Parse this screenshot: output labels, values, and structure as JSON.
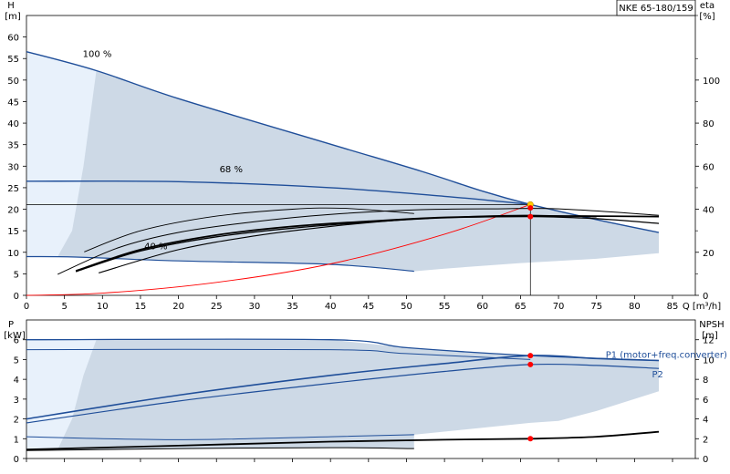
{
  "title": "NKE 65-180/159",
  "colors": {
    "envelope_fill": "#cdd9e6",
    "envelope_light": "#e8f1fb",
    "curve_blue": "#1f4e99",
    "curve_black": "#000000",
    "system_curve": "#ff0000",
    "duty_point": "#ff0000",
    "duty_point_yellow": "#ffcc00",
    "grid": "#000000"
  },
  "chart_data": [
    {
      "type": "line",
      "panel": "head",
      "xlabel": "Q [m³/h]",
      "ylabel_left": "H\n[m]",
      "ylabel_right": "eta\n[%]",
      "xlim": [
        0,
        88
      ],
      "ylim": [
        0,
        65
      ],
      "ylim_right": [
        0,
        130
      ],
      "x_ticks": [
        0,
        5,
        10,
        15,
        20,
        25,
        30,
        35,
        40,
        45,
        50,
        55,
        60,
        65,
        70,
        75,
        80,
        85
      ],
      "y_ticks": [
        0,
        5,
        10,
        15,
        20,
        25,
        30,
        35,
        40,
        45,
        50,
        55,
        60
      ],
      "y_ticks_right": [
        0,
        20,
        40,
        60,
        80,
        100
      ],
      "annotations": [
        "100 %",
        "68 %",
        "40 %"
      ],
      "duty_point": {
        "Q": 66.3,
        "H": 21.1
      },
      "series": [
        {
          "values": [
            [
              0,
              56.6
            ],
            [
              9.2,
              52.2
            ],
            [
              20,
              45.7
            ],
            [
              40,
              35.1
            ],
            [
              52,
              28.8
            ],
            [
              60,
              24.2
            ],
            [
              66.3,
              21.1
            ],
            [
              75,
              17.6
            ],
            [
              83.2,
              14.6
            ]
          ]
        },
        {
          "values": [
            [
              0,
              26.5
            ],
            [
              20,
              26.4
            ],
            [
              40,
              25.0
            ],
            [
              55,
              23.0
            ],
            [
              66.3,
              21.1
            ]
          ]
        },
        {
          "values": [
            [
              0,
              9.0
            ],
            [
              6.5,
              8.9
            ],
            [
              20,
              8.0
            ],
            [
              40,
              7.2
            ],
            [
              51,
              5.6
            ]
          ]
        },
        {
          "values": [
            [
              0,
              0
            ],
            [
              10,
              0.5
            ],
            [
              25,
              3.0
            ],
            [
              40,
              7.3
            ],
            [
              55,
              14.2
            ],
            [
              66.3,
              21.1
            ]
          ]
        },
        {
          "values": [
            [
              6.5,
              5.7
            ],
            [
              15,
              10.6
            ],
            [
              25,
              14.0
            ],
            [
              35,
              16.0
            ],
            [
              45,
              17.2
            ],
            [
              55,
              18.1
            ],
            [
              66.3,
              18.4
            ],
            [
              75,
              18.4
            ],
            [
              83.2,
              18.3
            ]
          ]
        },
        {
          "values": [
            [
              6.5,
              5.5
            ],
            [
              15,
              10.3
            ],
            [
              25,
              13.6
            ],
            [
              35,
              15.6
            ],
            [
              45,
              17.0
            ],
            [
              55,
              18.0
            ],
            [
              66.3,
              18.3
            ],
            [
              75,
              17.8
            ],
            [
              83.2,
              16.7
            ]
          ]
        },
        {
          "values": [
            [
              9.5,
              5.2
            ],
            [
              20,
              10.6
            ],
            [
              30,
              13.8
            ],
            [
              40,
              16.0
            ],
            [
              50,
              17.6
            ],
            [
              60,
              18.4
            ],
            [
              66.3,
              18.6
            ],
            [
              75,
              18.2
            ]
          ]
        },
        {
          "values": [
            [
              4.1,
              4.9
            ],
            [
              12,
              11.0
            ],
            [
              20,
              14.6
            ],
            [
              30,
              17.1
            ],
            [
              40,
              18.8
            ],
            [
              52,
              19.9
            ],
            [
              62,
              20.1
            ],
            [
              70,
              20.1
            ],
            [
              83.2,
              18.6
            ]
          ]
        },
        {
          "values": [
            [
              7.6,
              10.1
            ],
            [
              15,
              15.0
            ],
            [
              25,
              18.4
            ],
            [
              35,
              20.0
            ],
            [
              42,
              20.2
            ],
            [
              51,
              19.0
            ]
          ]
        }
      ]
    },
    {
      "type": "line",
      "panel": "power",
      "ylabel_left": "P\n[kW]",
      "ylabel_right": "NPSH\n[m]",
      "xlim": [
        0,
        88
      ],
      "ylim": [
        0,
        7
      ],
      "ylim_right": [
        0,
        14
      ],
      "y_ticks": [
        0,
        1,
        2,
        3,
        4,
        5,
        6
      ],
      "y_ticks_right": [
        0,
        2,
        4,
        6,
        8,
        10,
        12
      ],
      "annotations": [
        "P1 (motor+freq.converter)",
        "P2"
      ],
      "duty_points": [
        {
          "Q": 66.3,
          "P": 5.2
        },
        {
          "Q": 66.3,
          "P": 4.75
        },
        {
          "Q": 66.3,
          "NPSH": 2.0
        }
      ],
      "series": [
        {
          "name": "P1 (motor+freq.converter)",
          "values": [
            [
              0,
              2.0
            ],
            [
              20,
              3.2
            ],
            [
              40,
              4.2
            ],
            [
              55,
              4.8
            ],
            [
              66.3,
              5.2
            ],
            [
              75,
              5.05
            ],
            [
              83.2,
              4.95
            ]
          ]
        },
        {
          "name": "P2",
          "values": [
            [
              0,
              1.8
            ],
            [
              20,
              2.9
            ],
            [
              40,
              3.8
            ],
            [
              55,
              4.4
            ],
            [
              66.3,
              4.75
            ],
            [
              75,
              4.7
            ],
            [
              83.2,
              4.55
            ]
          ]
        },
        {
          "values": [
            [
              0,
              6.0
            ],
            [
              40,
              6.0
            ],
            [
              50,
              5.6
            ],
            [
              66.3,
              5.2
            ],
            [
              83.2,
              4.95
            ]
          ]
        },
        {
          "values": [
            [
              0,
              5.5
            ],
            [
              40,
              5.5
            ],
            [
              50,
              5.3
            ],
            [
              66.3,
              5.0
            ]
          ]
        },
        {
          "values": [
            [
              0,
              1.1
            ],
            [
              20,
              0.95
            ],
            [
              40,
              1.1
            ],
            [
              51,
              1.2
            ]
          ]
        },
        {
          "values": [
            [
              0,
              0.4
            ],
            [
              20,
              0.5
            ],
            [
              40,
              0.55
            ],
            [
              51,
              0.5
            ]
          ]
        },
        {
          "values": [
            [
              0,
              0.45
            ],
            [
              20,
              0.65
            ],
            [
              40,
              0.85
            ],
            [
              55,
              0.95
            ],
            [
              66.3,
              1.0
            ],
            [
              75,
              1.1
            ],
            [
              83.2,
              1.35
            ]
          ]
        }
      ]
    }
  ]
}
